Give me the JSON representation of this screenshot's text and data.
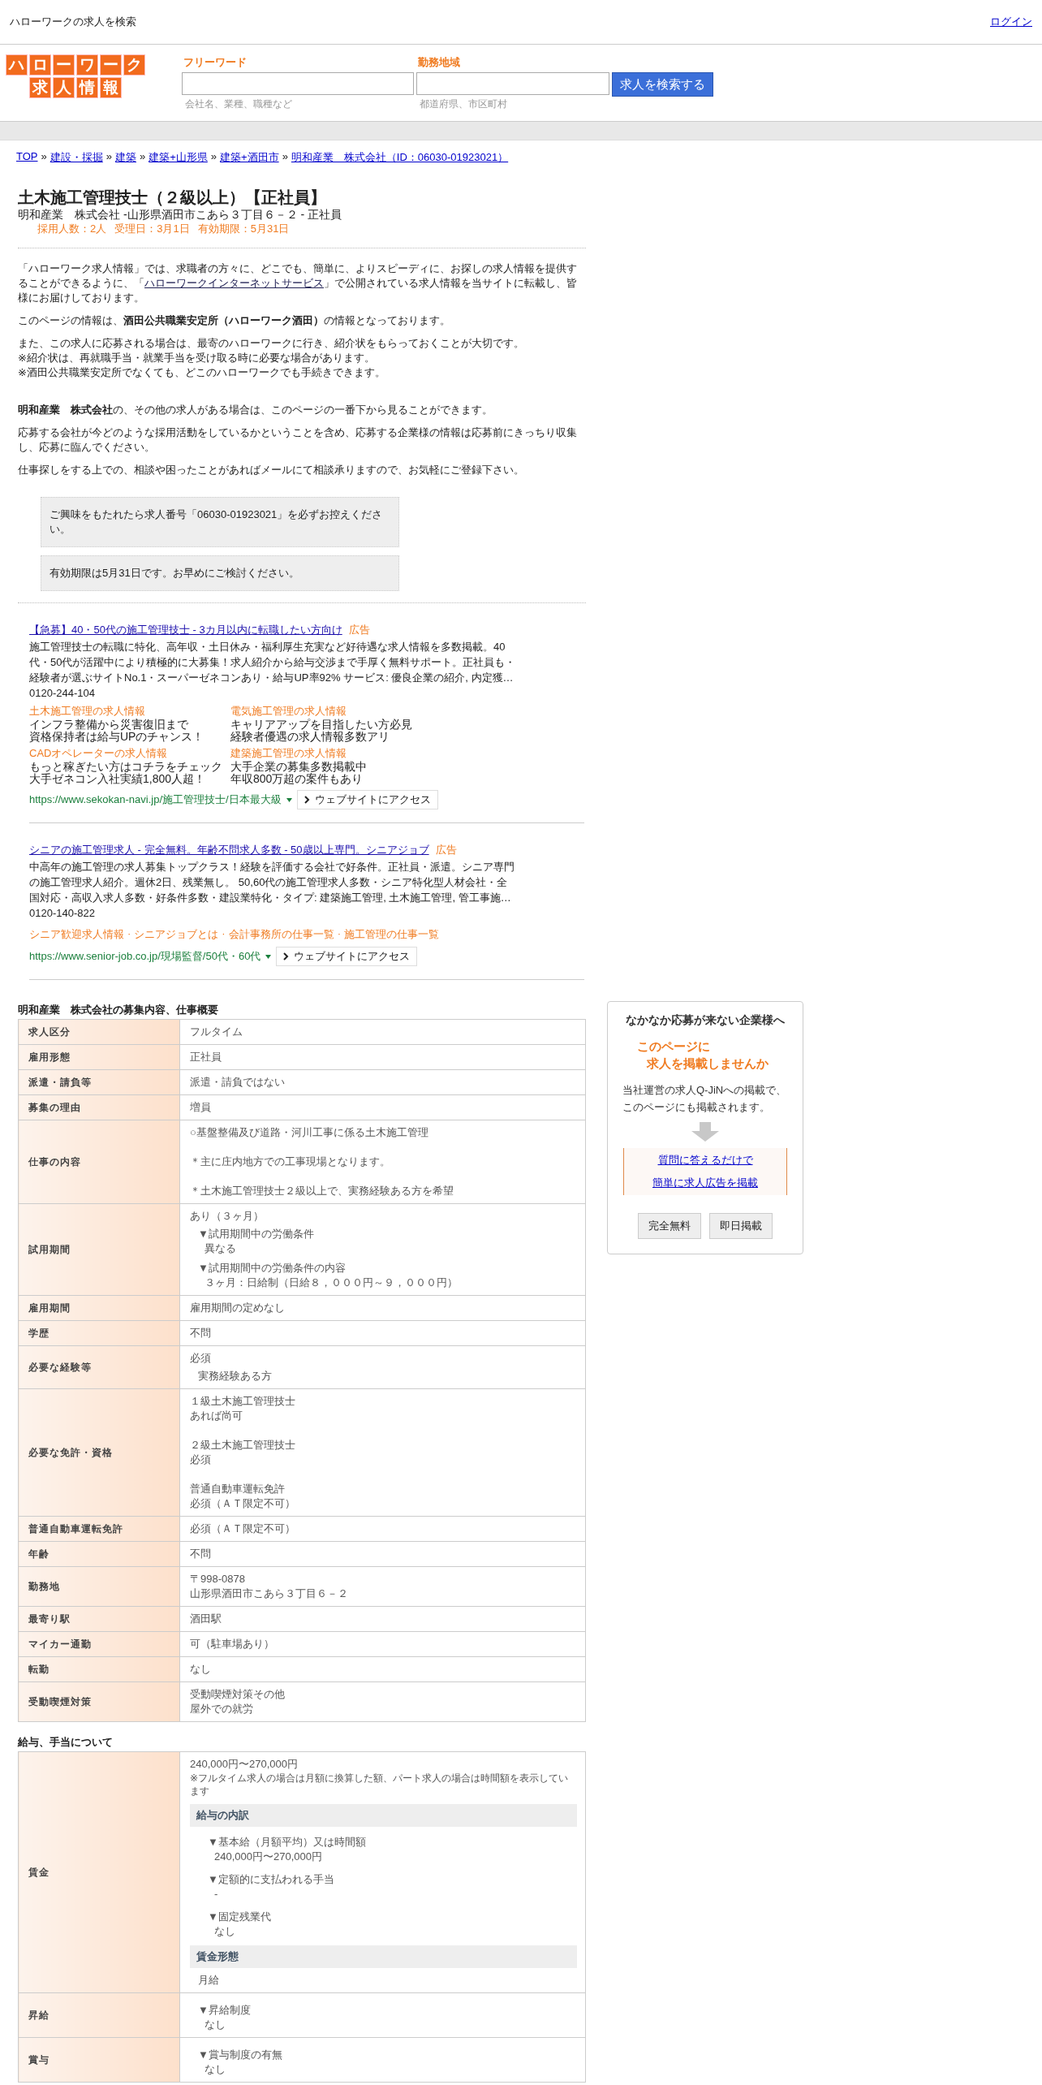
{
  "topbar": {
    "title": "ハローワークの求人を検索",
    "login": "ログイン"
  },
  "header": {
    "logo": {
      "line1": "ハローワーク",
      "line2": "求人情報"
    },
    "fields": [
      {
        "label": "フリーワード",
        "hint": "会社名、業種、職種など"
      },
      {
        "label": "勤務地域",
        "hint": "都道府県、市区町村"
      }
    ],
    "search_button": "求人を検索する"
  },
  "breadcrumb": {
    "separator": "»",
    "items": [
      "TOP",
      "建設・採掘",
      "建築",
      "建築+山形県",
      "建築+酒田市",
      "明和産業　株式会社（ID：06030-01923021）"
    ]
  },
  "job": {
    "title": "土木施工管理技士（２級以上）【正社員】",
    "subtitle": "明和産業　株式会社 -山形県酒田市こあら３丁目６－２ - 正社員",
    "meta": [
      "採用人数：2人",
      "受理日：3月1日",
      "有効期限：5月31日"
    ]
  },
  "intro": [
    {
      "before": "「ハローワーク求人情報」では、求職者の方々に、どこでも、簡単に、よりスピーディに、お探しの求人情報を提供することができるように、「",
      "link": "ハローワークインターネットサービス",
      "after": "」で公開されている求人情報を当サイトに転載し、皆様にお届けしております。"
    },
    {
      "text": "このページの情報は、**酒田公共職業安定所（ハローワーク酒田）**の情報となっております。"
    },
    {
      "lines": [
        "また、この求人に応募される場合は、最寄のハローワークに行き、紹介状をもらっておくことが大切です。",
        "※紹介状は、再就職手当・就業手当を受け取る時に必要な場合があります。",
        "※酒田公共職業安定所でなくても、どこのハローワークでも手続きできます。"
      ]
    },
    {
      "text": "**明和産業　株式会社**の、その他の求人がある場合は、このページの一番下から見ることができます。"
    },
    {
      "text": "応募する会社が今どのような採用活動をしているかということを含め、応募する企業様の情報は応募前にきっちり収集し、応募に臨んでください。"
    },
    {
      "text": "仕事探しをする上での、相談や困ったことがあればメールにて相談承りますので、お気軽にご登録下さい。"
    }
  ],
  "notices": [
    "ご興味をもたれたら求人番号「06030-01923021」を必ずお控えください。",
    "有効期限は5月31日です。お早めにご検討ください。"
  ],
  "ads": [
    {
      "title": "【急募】40・50代の施工管理技士 - 3カ月以内に転職したい方向け",
      "tag": "広告",
      "description": "施工管理技士の転職に特化、高年収・土日休み・福利厚生充実など好待遇な求人情報を多数掲載。40代・50代が活躍中により積極的に大募集！求人紹介から給与交渉まで手厚く無料サポート。正社員も・経験者が選ぶサイトNo.1・スーパーゼネコンあり・給与UP率92% サービス: 優良企業の紹介, 内定獲…",
      "phone": "0120-244-104",
      "kind": "grid",
      "sitelinks": [
        {
          "title": "土木施工管理の求人情報",
          "lines": [
            "インフラ整備から災害復旧まで",
            "資格保持者は給与UPのチャンス！"
          ]
        },
        {
          "title": "電気施工管理の求人情報",
          "lines": [
            "キャリアアップを目指したい方必見",
            "経験者優遇の求人情報多数アリ"
          ]
        },
        {
          "title": "CADオペレーターの求人情報",
          "lines": [
            "もっと稼ぎたい方はコチラをチェック",
            "大手ゼネコン入社実績1,800人超！"
          ]
        },
        {
          "title": "建築施工管理の求人情報",
          "lines": [
            "大手企業の募集多数掲載中",
            "年収800万超の案件もあり"
          ]
        }
      ],
      "url": "https://www.sekokan-navi.jp/施工管理技士/日本最大級",
      "button": "ウェブサイトにアクセス"
    },
    {
      "title": "シニアの施工管理求人 - 完全無料。年齢不問求人多数 - 50歳以上専門。シニアジョブ",
      "tag": "広告",
      "description": "中高年の施工管理の求人募集トップクラス！経験を評価する会社で好条件。正社員・派遣。シニア専門の施工管理求人紹介。週休2日、残業無し。 50,60代の施工管理求人多数・シニア特化型人材会社・全国対応・高収入求人多数・好条件多数・建設業特化・タイプ: 建築施工管理, 土木施工管理, 管工事施…",
      "phone": "0120-140-822",
      "kind": "inline",
      "separator": "·",
      "sitelinks": [
        {
          "title": "シニア歓迎求人情報"
        },
        {
          "title": "シニアジョブとは"
        },
        {
          "title": "会計事務所の仕事一覧"
        },
        {
          "title": "施工管理の仕事一覧"
        }
      ],
      "url": "https://www.senior-job.co.jp/現場監督/50代・60代",
      "button": "ウェブサイトにアクセス"
    }
  ],
  "sections": [
    {
      "title": "明和産業　株式会社の募集内容、仕事概要",
      "rows": [
        {
          "label": "求人区分",
          "blocks": [
            {
              "kind": "text",
              "lines": [
                "フルタイム"
              ]
            }
          ]
        },
        {
          "label": "雇用形態",
          "blocks": [
            {
              "kind": "text",
              "lines": [
                "正社員"
              ]
            }
          ]
        },
        {
          "label": "派遣・請負等",
          "blocks": [
            {
              "kind": "text",
              "lines": [
                "派遣・請負ではない"
              ]
            }
          ]
        },
        {
          "label": "募集の理由",
          "blocks": [
            {
              "kind": "text",
              "lines": [
                "増員"
              ]
            }
          ]
        },
        {
          "label": "仕事の内容",
          "blocks": [
            {
              "kind": "text",
              "lines": [
                "○基盤整備及び道路・河川工事に係る土木施工管理"
              ]
            },
            {
              "kind": "text",
              "lines": [
                "＊主に庄内地方での工事現場となります。"
              ]
            },
            {
              "kind": "text",
              "lines": [
                "＊土木施工管理技士２級以上で、実務経験ある方を希望"
              ]
            }
          ]
        },
        {
          "label": "試用期間",
          "blocks": [
            {
              "kind": "text",
              "lines": [
                "あり（３ヶ月）"
              ]
            },
            {
              "kind": "item",
              "title": "▼試用期間中の労働条件",
              "lines": [
                "異なる"
              ]
            },
            {
              "kind": "item",
              "title": "▼試用期間中の労働条件の内容",
              "lines": [
                "３ヶ月：日給制（日給８，０００円～９，０００円）"
              ]
            }
          ]
        },
        {
          "label": "雇用期間",
          "blocks": [
            {
              "kind": "text",
              "lines": [
                "雇用期間の定めなし"
              ]
            }
          ]
        },
        {
          "label": "学歴",
          "blocks": [
            {
              "kind": "text",
              "lines": [
                "不問"
              ]
            }
          ]
        },
        {
          "label": "必要な経験等",
          "blocks": [
            {
              "kind": "text",
              "lines": [
                "必須"
              ]
            },
            {
              "kind": "indent",
              "lines": [
                "実務経験ある方"
              ]
            }
          ]
        },
        {
          "label": "必要な免許・資格",
          "blocks": [
            {
              "kind": "text",
              "lines": [
                "１級土木施工管理技士",
                "あれば尚可"
              ]
            },
            {
              "kind": "text",
              "lines": [
                "２級土木施工管理技士",
                "必須"
              ]
            },
            {
              "kind": "text",
              "lines": [
                "普通自動車運転免許",
                "必須（ＡＴ限定不可）"
              ]
            }
          ]
        },
        {
          "label": "普通自動車運転免許",
          "blocks": [
            {
              "kind": "text",
              "lines": [
                "必須（ＡＴ限定不可）"
              ]
            }
          ]
        },
        {
          "label": "年齢",
          "blocks": [
            {
              "kind": "text",
              "lines": [
                "不問"
              ]
            }
          ]
        },
        {
          "label": "勤務地",
          "blocks": [
            {
              "kind": "text",
              "lines": [
                "〒998-0878",
                "山形県酒田市こあら３丁目６－２"
              ]
            }
          ]
        },
        {
          "label": "最寄り駅",
          "blocks": [
            {
              "kind": "text",
              "lines": [
                "酒田駅"
              ]
            }
          ]
        },
        {
          "label": "マイカー通勤",
          "blocks": [
            {
              "kind": "text",
              "lines": [
                "可（駐車場あり）"
              ]
            }
          ]
        },
        {
          "label": "転勤",
          "blocks": [
            {
              "kind": "text",
              "lines": [
                "なし"
              ]
            }
          ]
        },
        {
          "label": "受動喫煙対策",
          "blocks": [
            {
              "kind": "text",
              "lines": [
                "受動喫煙対策その他",
                "屋外での就労"
              ]
            }
          ]
        }
      ]
    },
    {
      "title": "給与、手当について",
      "rows": [
        {
          "label": "賃金",
          "blocks": [
            {
              "kind": "text",
              "lines": [
                "240,000円〜270,000円"
              ]
            },
            {
              "kind": "note",
              "lines": [
                "※フルタイム求人の場合は月額に換算した額、パート求人の場合は時間額を表示しています"
              ]
            },
            {
              "kind": "band",
              "lines": [
                "給与の内訳"
              ]
            },
            {
              "kind": "item",
              "title": "▼基本給（月額平均）又は時間額",
              "lines": [
                "240,000円〜270,000円"
              ]
            },
            {
              "kind": "item",
              "title": "▼定額的に支払われる手当",
              "lines": [
                "-"
              ]
            },
            {
              "kind": "item",
              "title": "▼固定残業代",
              "lines": [
                "なし"
              ]
            },
            {
              "kind": "band",
              "lines": [
                "賃金形態"
              ]
            },
            {
              "kind": "indent",
              "lines": [
                "月給"
              ]
            }
          ]
        },
        {
          "label": "昇給",
          "blocks": [
            {
              "kind": "item",
              "title": "▼昇給制度",
              "lines": [
                "なし"
              ]
            }
          ]
        },
        {
          "label": "賞与",
          "blocks": [
            {
              "kind": "item",
              "title": "▼賞与制度の有無",
              "lines": [
                "なし"
              ]
            }
          ]
        }
      ]
    }
  ],
  "sidebar": {
    "title": "なかなか応募が来ない企業様へ",
    "headline": [
      "このページに",
      "求人を掲載しませんか"
    ],
    "description": [
      "当社運営の求人Q-JiNへの掲載で、",
      "このページにも掲載されます。"
    ],
    "links": [
      "質問に答えるだけで",
      "簡単に求人広告を掲載"
    ],
    "badges": [
      "完全無料",
      "即日掲載"
    ]
  }
}
